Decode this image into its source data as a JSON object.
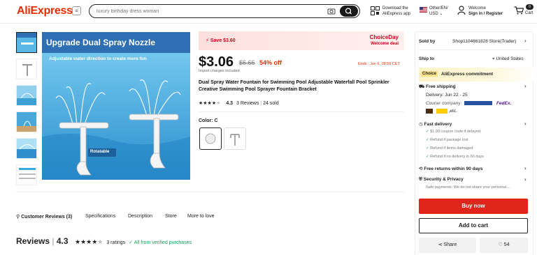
{
  "header": {
    "logo": "AliExpress",
    "search_placeholder": "luxury birthday dress woman",
    "download_line1": "Download the",
    "download_line2": "AliExpress app",
    "locale_line1": "Other/EN/",
    "locale_line2": "USD",
    "welcome_line1": "Welcome",
    "welcome_line2": "Sign in / Register",
    "cart_count": "0",
    "cart_label": "Cart"
  },
  "gallery": {
    "main_heading": "Upgrade Dual Spray Nozzle",
    "main_subheading": "Adjustable water direction to create more fun",
    "rotatable_label": "Rotatable"
  },
  "price_block": {
    "save": "Save $3.60",
    "choice_day": "ChoiceDay",
    "welcome_deal": "Welcome deal",
    "price": "$3.06",
    "old_price": "$6.66",
    "discount": "54% off",
    "ends": "Ends : Jun 6, 08:59 CET",
    "import_note": "Import charges included",
    "title": "Dual Spray Water Fountain for Swimming Pool Adjustable Waterfall Pool Sprinkler Creative Swimming Pool Sprayer Fountain Bracket",
    "rating": "4.3",
    "reviews": "3 Reviews",
    "sold": "24 sold",
    "color_label": "Color: C"
  },
  "panel": {
    "sold_by_label": "Sold by",
    "seller": "Shop1104661828 Store(Trader)",
    "ship_to_label": "Ship to",
    "ship_to": "United States",
    "choice_tag": "Choice",
    "choice_commit": "AliExpress commitment",
    "free_shipping": "Free shipping",
    "delivery": "Delivery: Jun 22 - 25",
    "courier": "Courier company:",
    "courier_etc": ",etc.",
    "fedex": "FedEx.",
    "fast_delivery": "Fast delivery",
    "fd1": "$1.00 coupon code if delayed",
    "fd2": "Refund if package lost",
    "fd3": "Refund if items damaged",
    "fd4": "Refund if no delivery in 60 days",
    "free_returns": "Free returns within 90 days",
    "security": "Security & Privacy",
    "security_note": "Safe payments: We do not share your personal ...",
    "buy_now": "Buy now",
    "add_to_cart": "Add to cart",
    "share": "Share",
    "likes": "54"
  },
  "tabs": [
    "Customer Reviews (3)",
    "Specifications",
    "Description",
    "Store",
    "More to love"
  ],
  "reviews": {
    "title": "Reviews",
    "score": "4.3",
    "ratings": "3 ratings",
    "verified": "All from verified purchases"
  },
  "colors": {
    "accent": "#e62e04",
    "buy": "#e1251b",
    "pool": "#3aa9e0"
  }
}
